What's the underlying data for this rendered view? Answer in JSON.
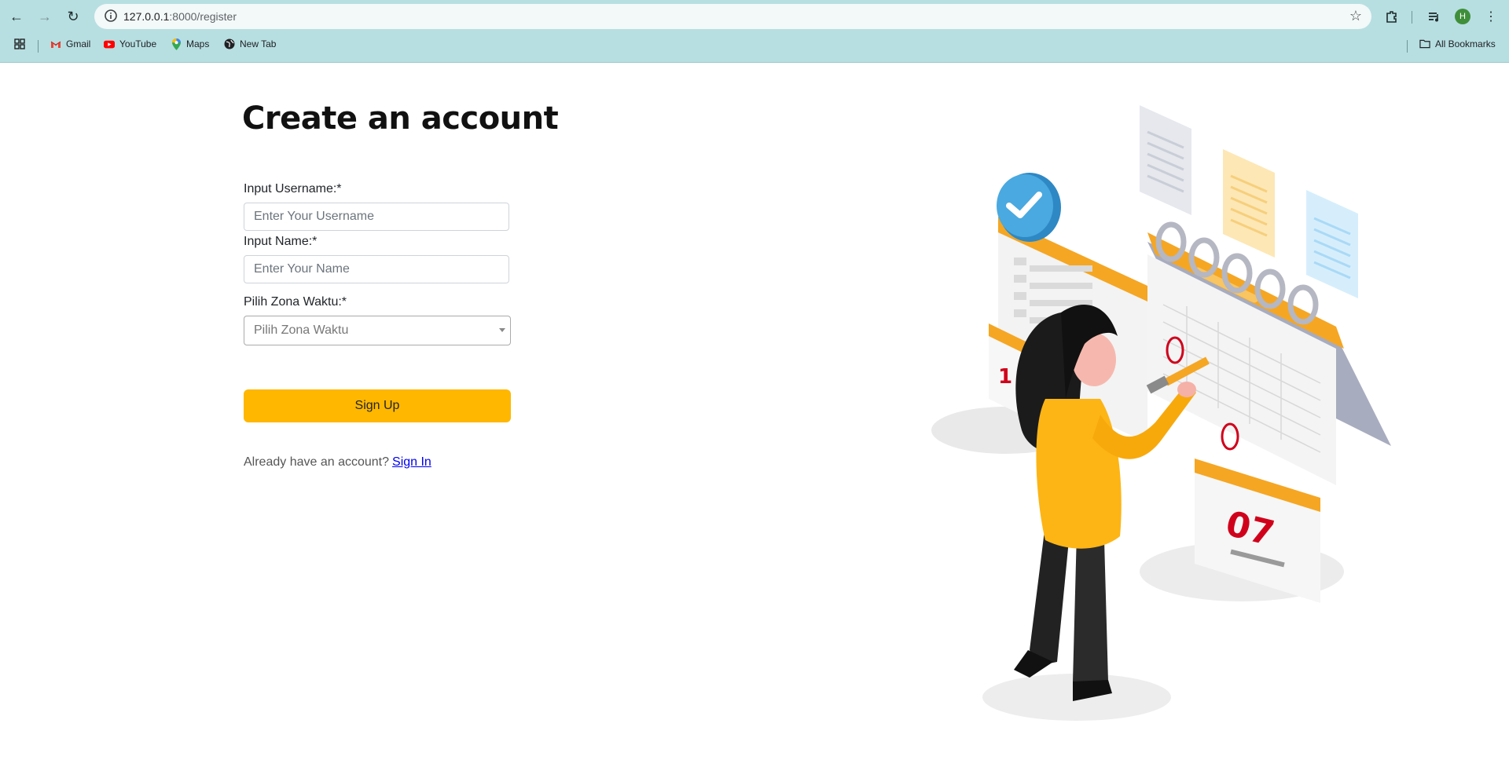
{
  "browser": {
    "url_host": "127.0.0.1",
    "url_path": ":8000/register",
    "avatar_initial": "H",
    "bookmarks": [
      {
        "label": "Gmail",
        "icon": "gmail-icon"
      },
      {
        "label": "YouTube",
        "icon": "youtube-icon"
      },
      {
        "label": "Maps",
        "icon": "maps-icon"
      },
      {
        "label": "New Tab",
        "icon": "globe-icon"
      }
    ],
    "all_bookmarks_label": "All Bookmarks"
  },
  "form": {
    "title": "Create an account",
    "username_label": "Input Username:*",
    "username_placeholder": "Enter Your Username",
    "name_label": "Input Name:*",
    "name_placeholder": "Enter Your Name",
    "timezone_label": "Pilih Zona Waktu:*",
    "timezone_placeholder": "Pilih Zona Waktu",
    "submit_label": "Sign Up",
    "already_text": "Already have an account?",
    "signin_link": "Sign In"
  },
  "illustration": {
    "calendar_date": "07",
    "colors": {
      "accent": "#ffb700",
      "calendar_orange": "#f5a623",
      "check_blue": "#4aa9e0"
    }
  }
}
